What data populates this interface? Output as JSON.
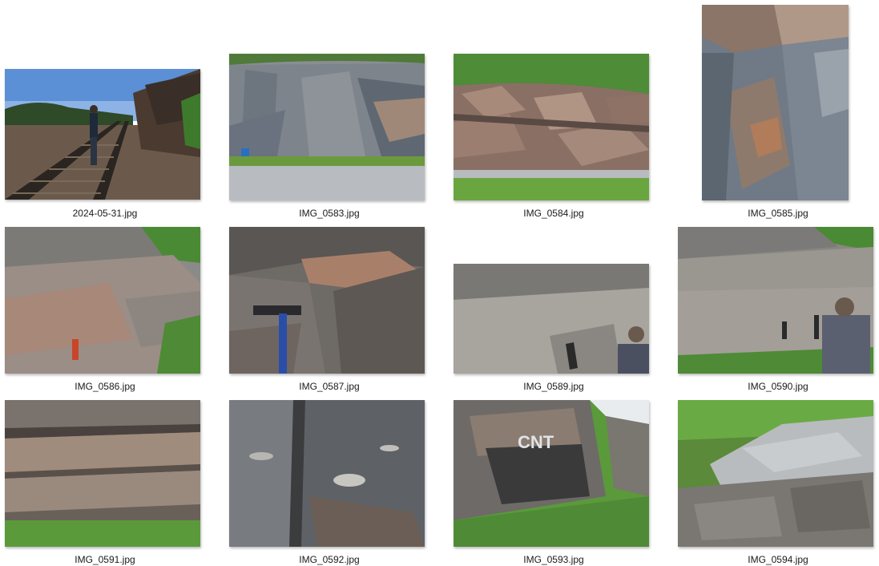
{
  "files": [
    {
      "name": "2024-05-31.jpg",
      "subject": "railroad-tracks-person"
    },
    {
      "name": "IMG_0583.jpg",
      "subject": "roadcut-cliff"
    },
    {
      "name": "IMG_0584.jpg",
      "subject": "roadcut-outcrop"
    },
    {
      "name": "IMG_0585.jpg",
      "subject": "rock-face-portrait"
    },
    {
      "name": "IMG_0586.jpg",
      "subject": "rock-outcrop"
    },
    {
      "name": "IMG_0587.jpg",
      "subject": "rock-hammer"
    },
    {
      "name": "IMG_0589.jpg",
      "subject": "rock-slab-person"
    },
    {
      "name": "IMG_0590.jpg",
      "subject": "rock-slab-person"
    },
    {
      "name": "IMG_0591.jpg",
      "subject": "layered-rock"
    },
    {
      "name": "IMG_0592.jpg",
      "subject": "rock-closeup"
    },
    {
      "name": "IMG_0593.jpg",
      "subject": "graffiti-rock-person"
    },
    {
      "name": "IMG_0594.jpg",
      "subject": "rock-slope-trees"
    }
  ]
}
